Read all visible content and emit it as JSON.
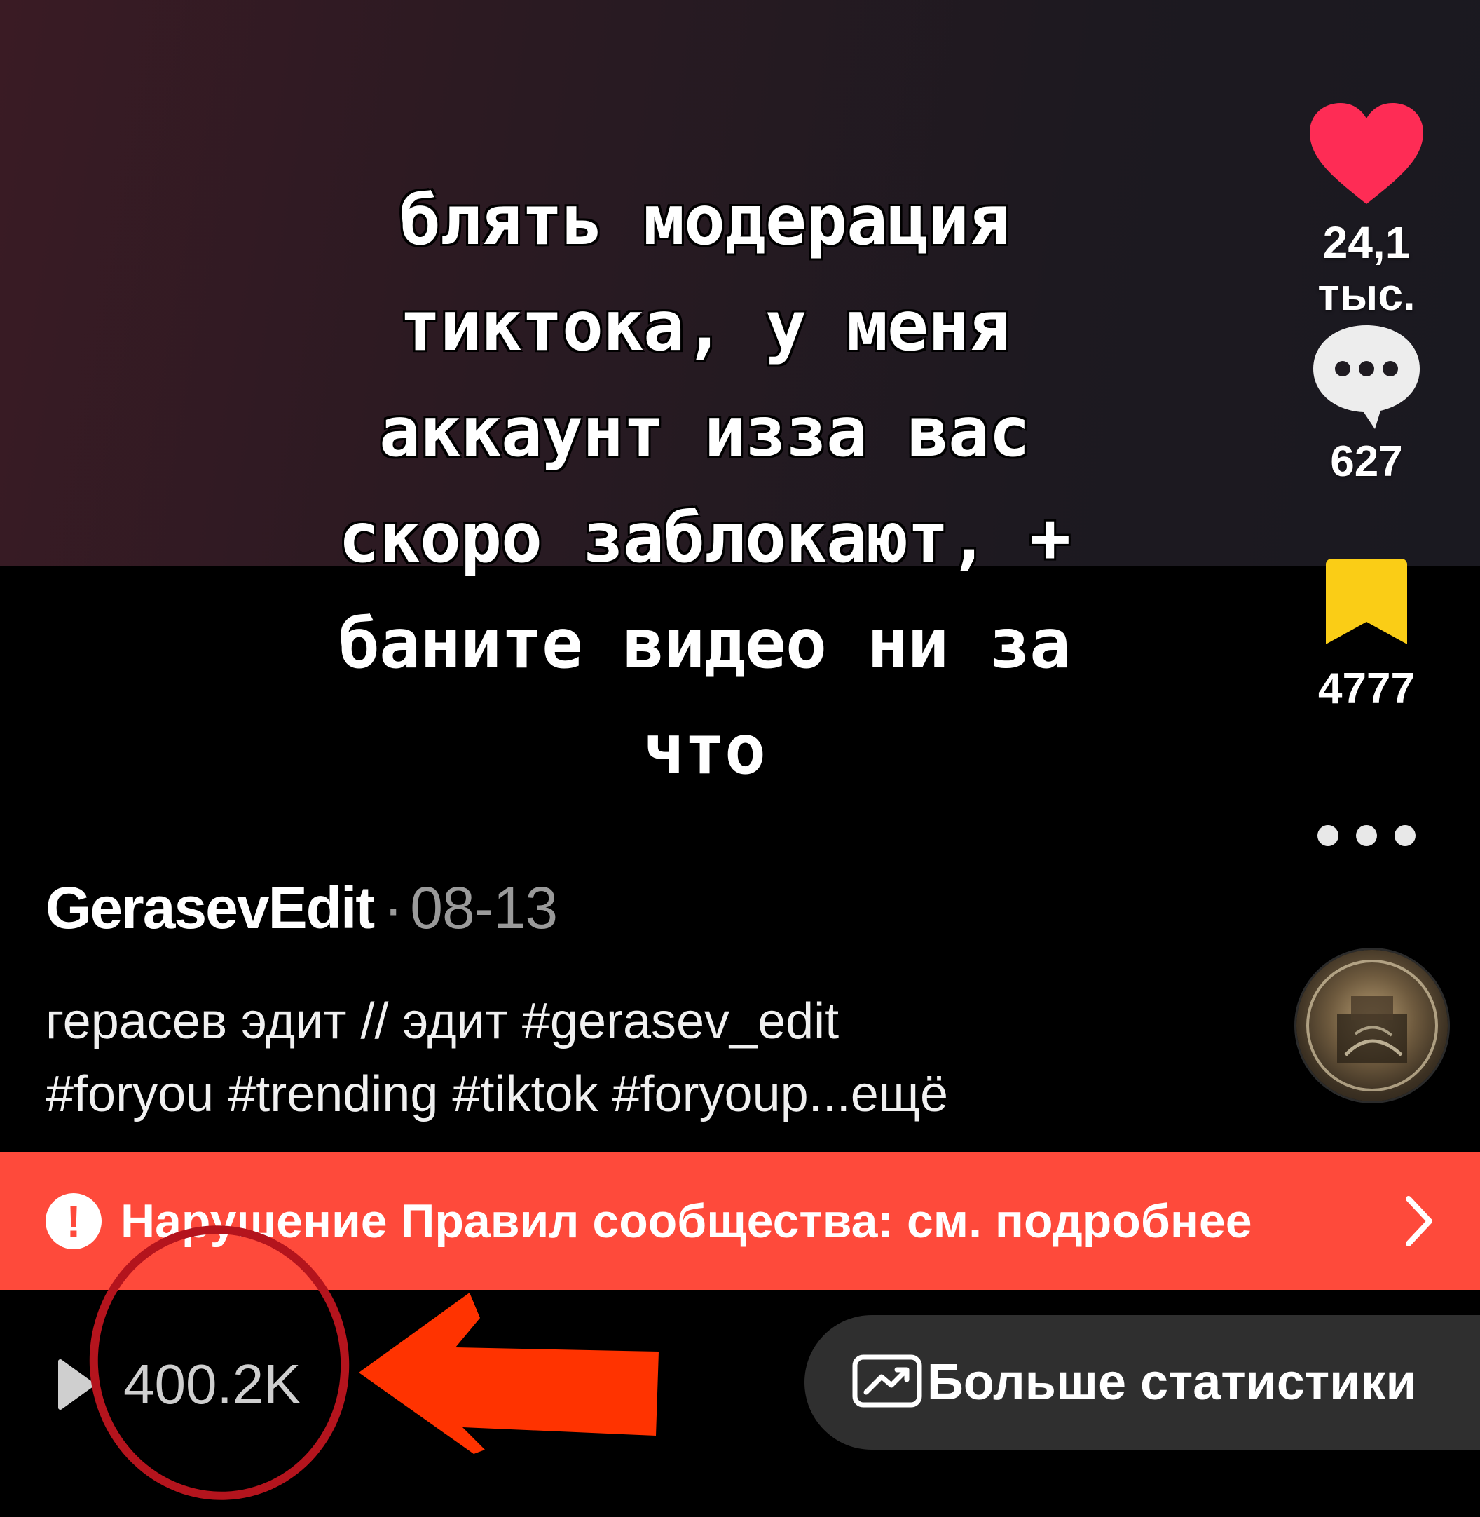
{
  "video": {
    "overlay_text": "блять модерация\nтиктока, у меня\nаккаунт изза вас\nскоро заблокают, +\nбаните видео ни за\nчто"
  },
  "actions": {
    "likes": "24,1 тыс.",
    "comments": "627",
    "bookmarks": "4777",
    "icons": {
      "like": "heart-icon",
      "comment": "comment-bubble-icon",
      "bookmark": "bookmark-icon",
      "more": "more-dots-icon"
    },
    "colors": {
      "like": "#fe2c55",
      "bookmark": "#facd16"
    }
  },
  "post": {
    "author": "GerasevEdit",
    "separator": "·",
    "date": "08-13",
    "caption_line1": "герасев эдит // эдит #gerasev_edit",
    "caption_line2": "#foryou #trending #tiktok #foryoup...",
    "more_link": "ещё"
  },
  "violation": {
    "text": "Нарушение Правил сообщества: см. подробнее",
    "icon": "exclamation-circle-icon",
    "chevron": "chevron-right-icon",
    "color": "#fe4a3b"
  },
  "footer": {
    "views": "400.2K",
    "stats_button": "Больше статистики",
    "icons": {
      "views": "play-icon",
      "stats": "trending-chart-icon"
    }
  },
  "annotations": {
    "circle_color": "#b4141d",
    "arrow_color": "#ff3300"
  }
}
